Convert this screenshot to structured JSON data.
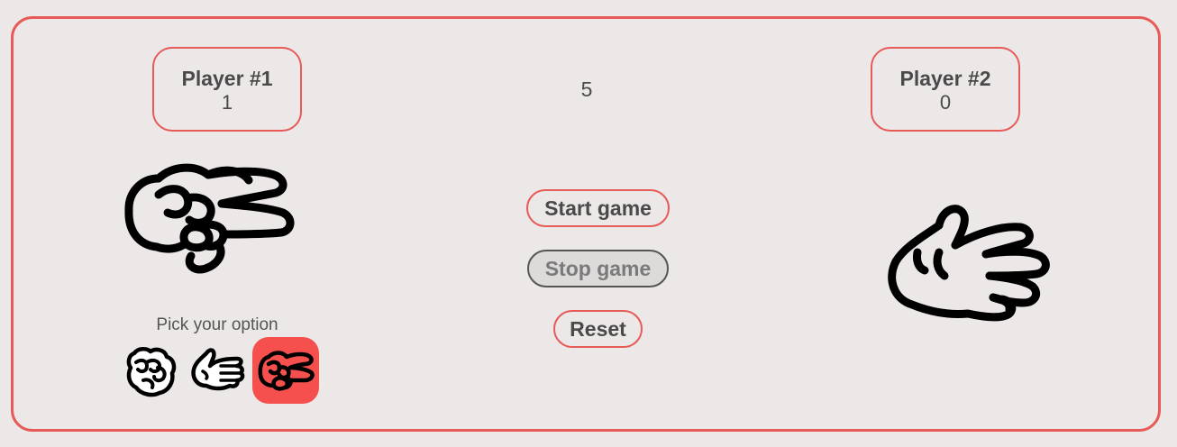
{
  "player1": {
    "name": "Player #1",
    "score": "1",
    "current_hand": "scissors-icon"
  },
  "player2": {
    "name": "Player #2",
    "score": "0",
    "current_hand": "paper-icon"
  },
  "round_counter": "5",
  "controls": {
    "start_label": "Start game",
    "stop_label": "Stop game",
    "reset_label": "Reset"
  },
  "picker": {
    "label": "Pick your option",
    "options": [
      "rock-icon",
      "paper-icon",
      "scissors-icon"
    ],
    "selected": "scissors-icon"
  },
  "colors": {
    "background": "#ebe8e7",
    "accent": "#e85a58",
    "selected_option": "#f5504e",
    "disabled_button_bg": "#dddada",
    "text": "#4a4a4a"
  }
}
